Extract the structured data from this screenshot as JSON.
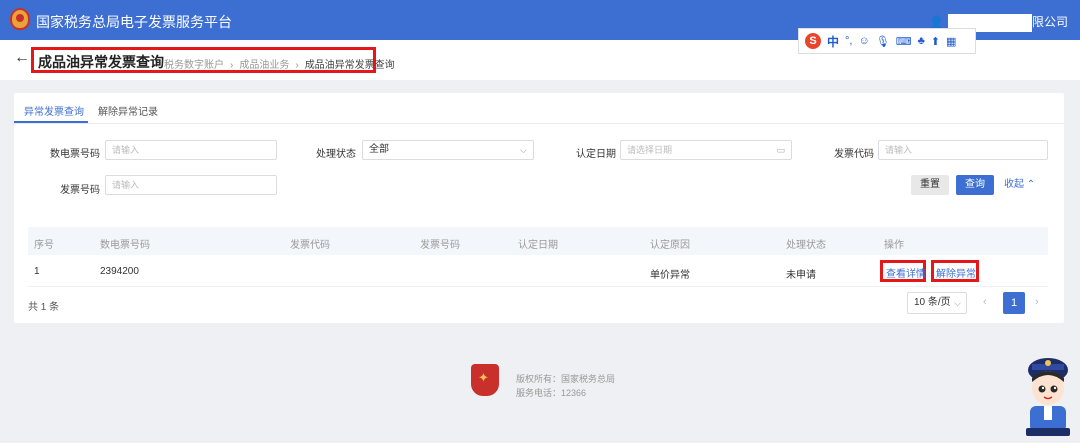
{
  "app": {
    "platform_title": "国家税务总局电子发票服务平台",
    "user_suffix": "限公司"
  },
  "header": {
    "page_title": "成品油异常发票查询",
    "breadcrumb": [
      "税务数字账户",
      "成品油业务",
      "成品油异常发票查询"
    ]
  },
  "ime": {
    "logo": "S",
    "lang": "中",
    "icons": [
      "punctuation-icon",
      "emoji-icon",
      "mic-icon",
      "keyboard-icon",
      "skin-icon",
      "upload-icon",
      "grid-icon"
    ]
  },
  "tabs": [
    {
      "label": "异常发票查询",
      "active": true
    },
    {
      "label": "解除异常记录",
      "active": false
    }
  ],
  "filters": {
    "digital_invoice_no": {
      "label": "数电票号码",
      "placeholder": "请输入"
    },
    "status": {
      "label": "处理状态",
      "value": "全部"
    },
    "confirm_date": {
      "label": "认定日期",
      "placeholder": "请选择日期"
    },
    "invoice_code": {
      "label": "发票代码",
      "placeholder": "请输入"
    },
    "invoice_no": {
      "label": "发票号码",
      "placeholder": "请输入"
    }
  },
  "buttons": {
    "reset": "重置",
    "query": "查询",
    "collapse": "收起"
  },
  "table": {
    "columns": [
      "序号",
      "数电票号码",
      "发票代码",
      "发票号码",
      "认定日期",
      "认定原因",
      "处理状态",
      "操作"
    ],
    "rows": [
      {
        "index": "1",
        "digital_invoice_no": "2394200",
        "invoice_code": "",
        "invoice_no": "",
        "confirm_date": "",
        "reason": "单价异常",
        "status": "未申请",
        "actions": [
          "查看详情",
          "解除异常"
        ]
      }
    ]
  },
  "pagination": {
    "total": "共 1 条",
    "page_size": "10 条/页",
    "current_page": "1"
  },
  "footer": {
    "copyright": "版权所有：国家税务总局",
    "phone": "服务电话：12366"
  },
  "colors": {
    "primary": "#3c6fd1",
    "highlight": "#e4171b",
    "background": "#eef0f3"
  }
}
